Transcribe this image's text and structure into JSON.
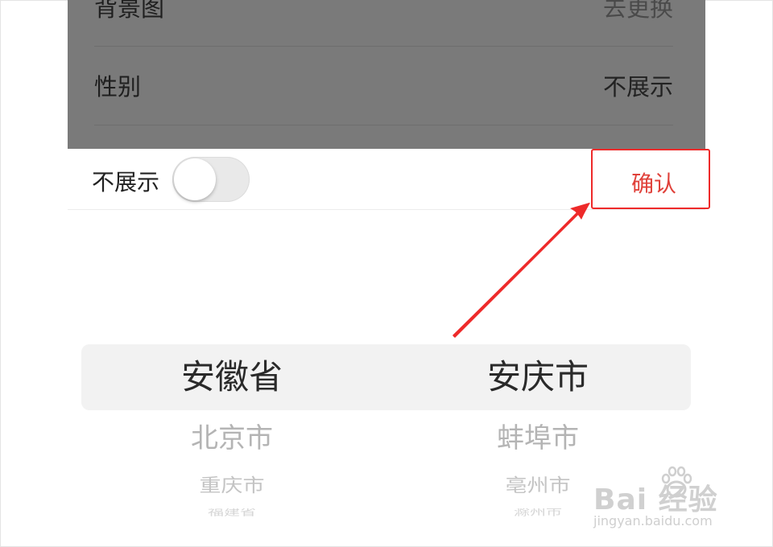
{
  "settings_list": {
    "rows": [
      {
        "label": "背景图",
        "value": "去更换"
      },
      {
        "label": "性别",
        "value": "不展示"
      },
      {
        "label": "",
        "value": ""
      }
    ]
  },
  "sheet": {
    "toggle_label": "不展示",
    "toggle_on": false,
    "confirm_label": "确认"
  },
  "picker": {
    "province": {
      "selected": "安徽省",
      "options_below": [
        "北京市",
        "重庆市",
        "福建省"
      ]
    },
    "city": {
      "selected": "安庆市",
      "options_below": [
        "蚌埠市",
        "亳州市",
        "滁州市"
      ]
    }
  },
  "watermark": {
    "brand": "Bai 经验",
    "url": "jingyan.baidu.com"
  },
  "colors": {
    "accent": "#e0413a",
    "annotation": "#ee2a2a",
    "overlay": "#7a7a7a"
  }
}
